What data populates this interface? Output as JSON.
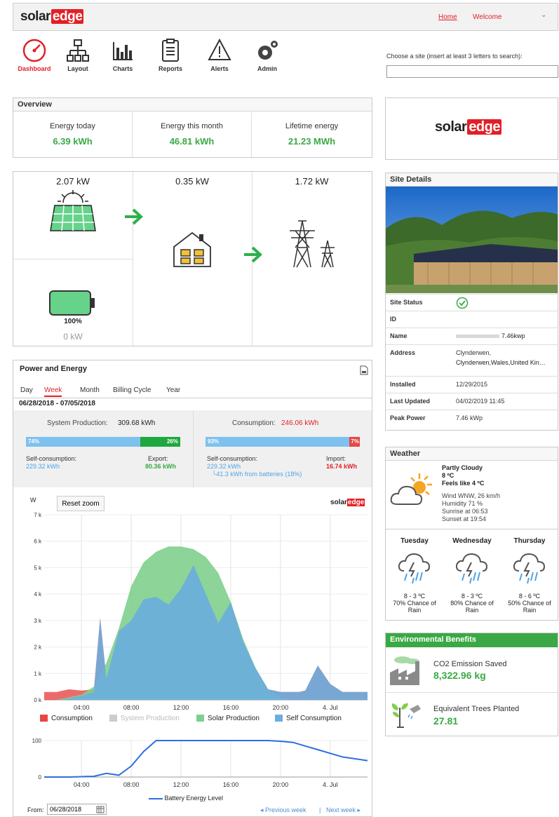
{
  "header": {
    "logo_a": "solar",
    "logo_b": "edge",
    "home": "Home",
    "welcome": "Welcome"
  },
  "nav": [
    {
      "label": "Dashboard",
      "icon": "speedometer-icon",
      "active": true
    },
    {
      "label": "Layout",
      "icon": "layout-tree-icon"
    },
    {
      "label": "Charts",
      "icon": "bar-chart-icon"
    },
    {
      "label": "Reports",
      "icon": "clipboard-icon"
    },
    {
      "label": "Alerts",
      "icon": "warning-icon"
    },
    {
      "label": "Admin",
      "icon": "gears-icon"
    }
  ],
  "site_search": {
    "label": "Choose a site (insert at least 3 letters to search):",
    "value": ""
  },
  "overview": {
    "title": "Overview",
    "today_label": "Energy today",
    "today_value": "6.39 kWh",
    "month_label": "Energy this month",
    "month_value": "46.81 kWh",
    "life_label": "Lifetime energy",
    "life_value": "21.23 MWh"
  },
  "flow": {
    "solar_kw": "2.07 kW",
    "home_kw": "0.35 kW",
    "grid_kw": "1.72 kW",
    "battery_pct": "100%",
    "battery_kw": "0 kW"
  },
  "power_energy": {
    "title": "Power and Energy",
    "tabs": [
      "Day",
      "Week",
      "Month",
      "Billing Cycle",
      "Year"
    ],
    "active_tab": "Week",
    "date_range": "06/28/2018 - 07/05/2018",
    "sys_prod_label": "System Production:",
    "sys_prod_value": "309.68 kWh",
    "consumption_label": "Consumption:",
    "consumption_value": "246.06 kWh",
    "prod_bar_left": "74%",
    "prod_bar_right": "26%",
    "prod_split": 0.74,
    "cons_bar_left": "93%",
    "cons_bar_right": "7%",
    "cons_split": 0.93,
    "selfcons_label": "Self-consumption:",
    "selfcons_value": "229.32 kWh",
    "export_label": "Export:",
    "export_value": "80.36 kWh",
    "selfcons2_label": "Self-consumption:",
    "selfcons2_value": "229.32 kWh",
    "from_batt": "└41.3 kWh from batteries (18%)",
    "import_label": "Import:",
    "import_value": "16.74 kWh",
    "reset_zoom": "Reset zoom",
    "chart_unit": "W",
    "legend": [
      "Consumption",
      "System Production",
      "Solar Production",
      "Self Consumption"
    ],
    "battery_legend": "Battery Energy Level",
    "from_label": "From:",
    "from_value": "06/28/2018",
    "prev_week": "◂ Previous week",
    "sep": "|",
    "next_week": "Next week ▸"
  },
  "chart_data": [
    {
      "type": "area",
      "ylabel": "W",
      "ylim": [
        0,
        7000
      ],
      "y_ticks": [
        "0 k",
        "1 k",
        "2 k",
        "3 k",
        "4 k",
        "5 k",
        "6 k",
        "7 k"
      ],
      "x_ticks": [
        "04:00",
        "08:00",
        "12:00",
        "16:00",
        "20:00",
        "4. Jul"
      ],
      "x": [
        0,
        1,
        2,
        3,
        4,
        4.5,
        5,
        6,
        7,
        8,
        9,
        10,
        11,
        12,
        13,
        14,
        15,
        16,
        17,
        18,
        19,
        20,
        20.5,
        21,
        22,
        23,
        24,
        25,
        26
      ],
      "series": [
        {
          "name": "Solar Production",
          "color": "#7fcf8c",
          "values": [
            0,
            0,
            100,
            200,
            500,
            900,
            1400,
            2700,
            4300,
            5200,
            5600,
            5800,
            5800,
            5700,
            5400,
            4800,
            3700,
            2300,
            1200,
            400,
            100,
            0,
            0,
            0,
            0,
            0,
            0,
            0,
            0
          ]
        },
        {
          "name": "Self Consumption",
          "color": "#6aaee0",
          "values": [
            0,
            0,
            50,
            150,
            300,
            3100,
            800,
            2600,
            3000,
            3800,
            3900,
            3600,
            4200,
            5100,
            4000,
            2900,
            3700,
            2200,
            1200,
            400,
            300,
            300,
            300,
            350,
            1300,
            600,
            300,
            300,
            300
          ]
        },
        {
          "name": "Consumption",
          "color": "#e84545",
          "values": [
            300,
            300,
            400,
            350,
            400,
            3100,
            800,
            2600,
            3000,
            3800,
            3900,
            3600,
            4200,
            5100,
            4000,
            2900,
            3700,
            2200,
            1200,
            400,
            300,
            300,
            300,
            350,
            1300,
            600,
            300,
            300,
            300
          ]
        },
        {
          "name": "System Production",
          "color": "#cccccc",
          "values": []
        }
      ]
    },
    {
      "type": "line",
      "ylim": [
        0,
        100
      ],
      "y_ticks": [
        "0",
        "100"
      ],
      "x_ticks": [
        "04:00",
        "08:00",
        "12:00",
        "16:00",
        "20:00",
        "4. Jul"
      ],
      "x": [
        0,
        2,
        4,
        5,
        6,
        7,
        8,
        9,
        10,
        12,
        14,
        16,
        18,
        19,
        20,
        21,
        22,
        23,
        24,
        26
      ],
      "series": [
        {
          "name": "Battery Energy Level",
          "color": "#2b6fe0",
          "values": [
            0,
            0,
            2,
            10,
            5,
            30,
            70,
            100,
            100,
            100,
            100,
            100,
            100,
            98,
            95,
            85,
            75,
            65,
            55,
            45
          ]
        }
      ]
    }
  ],
  "site_details": {
    "title": "Site Details",
    "rows": [
      {
        "k": "Site Status",
        "v": ""
      },
      {
        "k": "ID",
        "v": ""
      },
      {
        "k": "Name",
        "v": "7.46kwp"
      },
      {
        "k": "Address",
        "v": "Clynderwen,"
      },
      {
        "k": "Installed",
        "v": "12/29/2015"
      },
      {
        "k": "Last Updated",
        "v": "04/02/2019 11:45"
      },
      {
        "k": "Peak Power",
        "v": "7.46 kWp"
      }
    ],
    "address_line2": "Clynderwen,Wales,United Kin…"
  },
  "weather": {
    "title": "Weather",
    "condition": "Partly Cloudy",
    "temp": "8 ºC",
    "feels": "Feels like 4 ºC",
    "wind": "Wind WNW, 26 km/h",
    "humidity": "Humidity 71 %",
    "sunrise": "Sunrise at 06:53",
    "sunset": "Sunset at 19:54",
    "forecast": [
      {
        "day": "Tuesday",
        "range": "8 - 3 ºC",
        "chance": "70% Chance of",
        "cond": "Rain"
      },
      {
        "day": "Wednesday",
        "range": "8 - 3 ºC",
        "chance": "80% Chance of",
        "cond": "Rain"
      },
      {
        "day": "Thursday",
        "range": "8 - 6 ºC",
        "chance": "50% Chance of",
        "cond": "Rain"
      }
    ]
  },
  "env": {
    "title": "Environmental Benefits",
    "co2_label": "CO2 Emission Saved",
    "co2_value": "8,322.96 kg",
    "trees_label": "Equivalent Trees Planted",
    "trees_value": "27.81"
  },
  "colors": {
    "brand_red": "#e31f26",
    "green": "#3aa945",
    "blue": "#4fa4e6",
    "env_green": "#3aa945"
  }
}
